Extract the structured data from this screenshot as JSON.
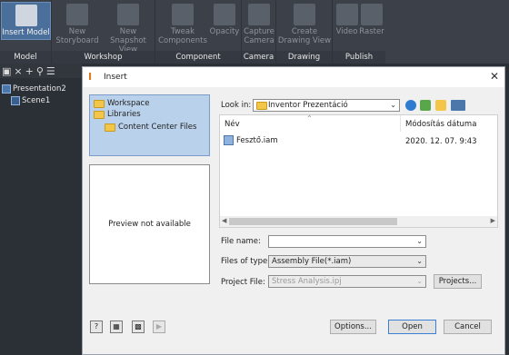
{
  "ribbon": {
    "panels": [
      {
        "label": "Model",
        "buttons": [
          {
            "label": "Insert Model",
            "enabled": true
          }
        ]
      },
      {
        "label": "Workshop",
        "buttons": [
          {
            "label1": "New",
            "label2": "Storyboard"
          },
          {
            "label1": "New",
            "label2": "Snapshot View"
          }
        ]
      },
      {
        "label": "Component",
        "buttons": [
          {
            "label1": "Tweak",
            "label2": "Components"
          },
          {
            "label1": "Opacity",
            "label2": ""
          }
        ]
      },
      {
        "label": "Camera",
        "buttons": [
          {
            "label1": "Capture",
            "label2": "Camera"
          }
        ]
      },
      {
        "label": "Drawing",
        "buttons": [
          {
            "label1": "Create",
            "label2": "Drawing View"
          }
        ]
      },
      {
        "label": "Publish",
        "buttons": [
          {
            "label1": "Video",
            "label2": ""
          },
          {
            "label1": "Raster",
            "label2": ""
          }
        ]
      }
    ]
  },
  "browser": {
    "items": [
      "Presentation2",
      "Scene1"
    ]
  },
  "dialog": {
    "title": "Insert",
    "places": [
      "Workspace",
      "Libraries",
      "Content Center Files"
    ],
    "preview_text": "Preview not available",
    "look_in_label": "Look in:",
    "look_in_value": "Inventor Prezentáció",
    "columns": {
      "name": "Név",
      "date": "Módosítás dátuma"
    },
    "files": [
      {
        "name": "Fesztő.iam",
        "date": "2020. 12. 07. 9:43"
      }
    ],
    "file_name_label": "File name:",
    "file_name_value": "",
    "files_of_type_label": "Files of type:",
    "files_of_type_value": "Assembly File(*.iam)",
    "project_file_label": "Project File:",
    "project_file_value": "Stress Analysis.ipj",
    "buttons": {
      "projects": "Projects...",
      "options": "Options...",
      "open": "Open",
      "cancel": "Cancel"
    }
  }
}
